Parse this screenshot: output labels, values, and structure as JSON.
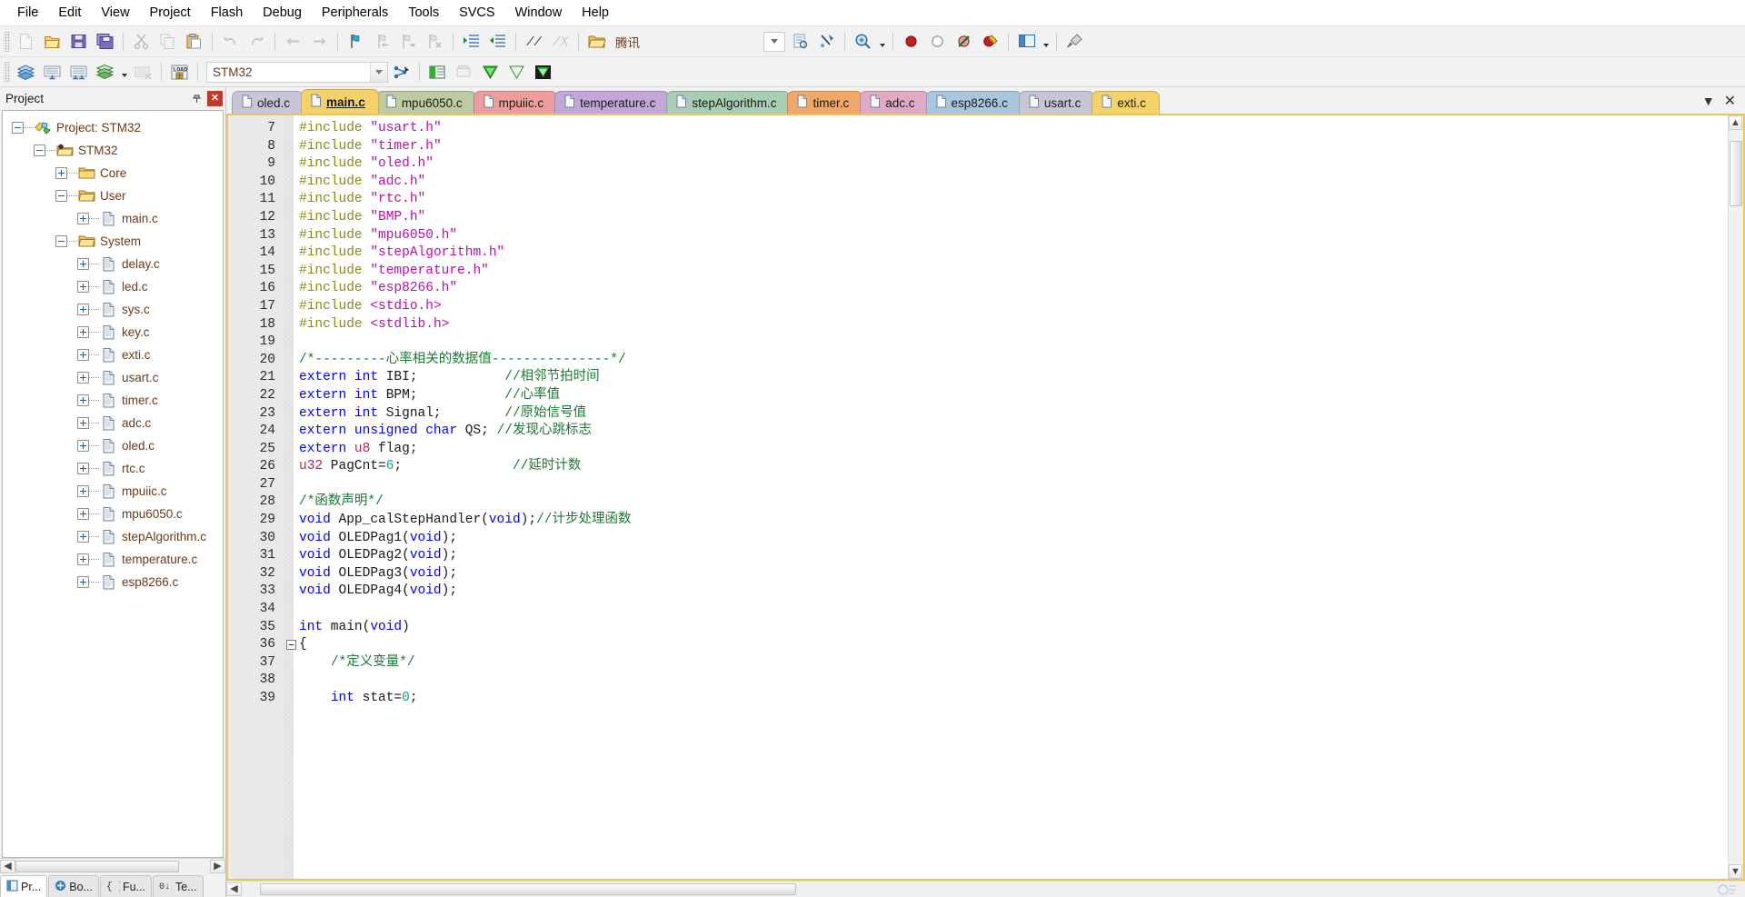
{
  "menu": {
    "items": [
      "File",
      "Edit",
      "View",
      "Project",
      "Flash",
      "Debug",
      "Peripherals",
      "Tools",
      "SVCS",
      "Window",
      "Help"
    ]
  },
  "toolbar1": {
    "buttons": [
      {
        "name": "new-file-button",
        "title": "New"
      },
      {
        "name": "open-file-button",
        "title": "Open"
      },
      {
        "name": "save-button",
        "title": "Save"
      },
      {
        "name": "save-all-button",
        "title": "Save All"
      },
      {
        "name": "cut-button",
        "title": "Cut"
      },
      {
        "name": "copy-button",
        "title": "Copy"
      },
      {
        "name": "paste-button",
        "title": "Paste"
      },
      {
        "name": "undo-button",
        "title": "Undo"
      },
      {
        "name": "redo-button",
        "title": "Redo"
      },
      {
        "name": "navigate-back-button",
        "title": "Back"
      },
      {
        "name": "navigate-forward-button",
        "title": "Forward"
      },
      {
        "name": "bookmark-toggle-button",
        "title": "Insert/Remove Bookmark"
      },
      {
        "name": "bookmark-prev-button",
        "title": "Previous Bookmark"
      },
      {
        "name": "bookmark-next-button",
        "title": "Next Bookmark"
      },
      {
        "name": "bookmark-clear-button",
        "title": "Clear All Bookmarks"
      },
      {
        "name": "indent-increase-button",
        "title": "Indent"
      },
      {
        "name": "indent-decrease-button",
        "title": "Outdent"
      },
      {
        "name": "comment-button",
        "title": "Comment"
      },
      {
        "name": "uncomment-button",
        "title": "Uncomment"
      },
      {
        "name": "open-folder-button",
        "title": "Open Containing Folder"
      }
    ],
    "tencent_label": "腾讯",
    "find_label": "",
    "debug_buttons": [
      {
        "name": "breakpoint-insert-button"
      },
      {
        "name": "breakpoint-disable-button"
      },
      {
        "name": "breakpoint-disable-all-button"
      },
      {
        "name": "breakpoint-kill-all-button"
      }
    ]
  },
  "toolbar2": {
    "buttons": [
      {
        "name": "build-target-button"
      },
      {
        "name": "translate-file-button"
      },
      {
        "name": "rebuild-all-button"
      },
      {
        "name": "batch-build-button"
      },
      {
        "name": "stop-build-button"
      },
      {
        "name": "download-to-flash-button"
      }
    ],
    "target_selector": {
      "value": "STM32",
      "name": "target-selector"
    },
    "after_buttons": [
      {
        "name": "target-options-button"
      },
      {
        "name": "manage-project-items-button"
      },
      {
        "name": "configuration-wizard-button"
      },
      {
        "name": "pack-installer-button"
      },
      {
        "name": "manage-run-time-environment-button"
      }
    ]
  },
  "project_pane": {
    "title": "Project",
    "pin_icon": "pin-icon",
    "close_icon": "close-icon",
    "tree": [
      {
        "label": "Project: STM32",
        "depth": 0,
        "state": "minus",
        "icon": "project-icon"
      },
      {
        "label": "STM32",
        "depth": 1,
        "state": "minus",
        "icon": "target-folder-icon"
      },
      {
        "label": "Core",
        "depth": 2,
        "state": "plus",
        "icon": "group-folder-icon"
      },
      {
        "label": "User",
        "depth": 2,
        "state": "minus",
        "icon": "group-folder-icon"
      },
      {
        "label": "main.c",
        "depth": 3,
        "state": "plus",
        "icon": "c-file-icon"
      },
      {
        "label": "System",
        "depth": 2,
        "state": "minus",
        "icon": "group-folder-icon"
      },
      {
        "label": "delay.c",
        "depth": 3,
        "state": "plus",
        "icon": "c-file-icon"
      },
      {
        "label": "led.c",
        "depth": 3,
        "state": "plus",
        "icon": "c-file-icon"
      },
      {
        "label": "sys.c",
        "depth": 3,
        "state": "plus",
        "icon": "c-file-icon"
      },
      {
        "label": "key.c",
        "depth": 3,
        "state": "plus",
        "icon": "c-file-icon"
      },
      {
        "label": "exti.c",
        "depth": 3,
        "state": "plus",
        "icon": "c-file-icon"
      },
      {
        "label": "usart.c",
        "depth": 3,
        "state": "plus",
        "icon": "c-file-icon"
      },
      {
        "label": "timer.c",
        "depth": 3,
        "state": "plus",
        "icon": "c-file-icon"
      },
      {
        "label": "adc.c",
        "depth": 3,
        "state": "plus",
        "icon": "c-file-icon"
      },
      {
        "label": "oled.c",
        "depth": 3,
        "state": "plus",
        "icon": "c-file-icon"
      },
      {
        "label": "rtc.c",
        "depth": 3,
        "state": "plus",
        "icon": "c-file-icon"
      },
      {
        "label": "mpuiic.c",
        "depth": 3,
        "state": "plus",
        "icon": "c-file-icon"
      },
      {
        "label": "mpu6050.c",
        "depth": 3,
        "state": "plus",
        "icon": "c-file-icon"
      },
      {
        "label": "stepAlgorithm.c",
        "depth": 3,
        "state": "plus",
        "icon": "c-file-icon"
      },
      {
        "label": "temperature.c",
        "depth": 3,
        "state": "plus",
        "icon": "c-file-icon"
      },
      {
        "label": "esp8266.c",
        "depth": 3,
        "state": "plus",
        "icon": "c-file-icon"
      }
    ],
    "bottom_tabs": [
      {
        "label": "Pr...",
        "icon": "project-tab-icon",
        "active": true
      },
      {
        "label": "Bo...",
        "icon": "books-tab-icon",
        "active": false
      },
      {
        "label": "Fu...",
        "icon": "functions-tab-icon",
        "active": false
      },
      {
        "label": "Te...",
        "icon": "templates-tab-icon",
        "active": false
      }
    ]
  },
  "editor": {
    "tabs": [
      {
        "label": "oled.c",
        "color": "#c8c6d6",
        "active": false
      },
      {
        "label": "main.c",
        "color": "#f5d269",
        "active": true
      },
      {
        "label": "mpu6050.c",
        "color": "#bccba2",
        "active": false
      },
      {
        "label": "mpuiic.c",
        "color": "#ed9d9d",
        "active": false
      },
      {
        "label": "temperature.c",
        "color": "#c2a8d8",
        "active": false
      },
      {
        "label": "stepAlgorithm.c",
        "color": "#a8cdb4",
        "active": false
      },
      {
        "label": "timer.c",
        "color": "#f0a868",
        "active": false
      },
      {
        "label": "adc.c",
        "color": "#dfaac4",
        "active": false
      },
      {
        "label": "esp8266.c",
        "color": "#a9c6dc",
        "active": false
      },
      {
        "label": "usart.c",
        "color": "#c8c6d6",
        "active": false
      },
      {
        "label": "exti.c",
        "color": "#f5d269",
        "active": false
      }
    ],
    "tab_list_icon": "tab-list-icon",
    "tab_close_icon": "close-icon",
    "first_line_number": 7,
    "lines": [
      {
        "n": 7,
        "tokens": [
          {
            "t": "#include ",
            "c": "pp"
          },
          {
            "t": "\"usart.h\"",
            "c": "st"
          }
        ]
      },
      {
        "n": 8,
        "tokens": [
          {
            "t": "#include ",
            "c": "pp"
          },
          {
            "t": "\"timer.h\"",
            "c": "st"
          }
        ]
      },
      {
        "n": 9,
        "tokens": [
          {
            "t": "#include ",
            "c": "pp"
          },
          {
            "t": "\"oled.h\"",
            "c": "st"
          }
        ]
      },
      {
        "n": 10,
        "tokens": [
          {
            "t": "#include ",
            "c": "pp"
          },
          {
            "t": "\"adc.h\"",
            "c": "st"
          }
        ]
      },
      {
        "n": 11,
        "tokens": [
          {
            "t": "#include ",
            "c": "pp"
          },
          {
            "t": "\"rtc.h\"",
            "c": "st"
          }
        ]
      },
      {
        "n": 12,
        "tokens": [
          {
            "t": "#include ",
            "c": "pp"
          },
          {
            "t": "\"BMP.h\"",
            "c": "st"
          }
        ]
      },
      {
        "n": 13,
        "tokens": [
          {
            "t": "#include ",
            "c": "pp"
          },
          {
            "t": "\"mpu6050.h\"",
            "c": "st"
          }
        ]
      },
      {
        "n": 14,
        "tokens": [
          {
            "t": "#include ",
            "c": "pp"
          },
          {
            "t": "\"stepAlgorithm.h\"",
            "c": "st"
          }
        ]
      },
      {
        "n": 15,
        "tokens": [
          {
            "t": "#include ",
            "c": "pp"
          },
          {
            "t": "\"temperature.h\"",
            "c": "st"
          }
        ]
      },
      {
        "n": 16,
        "tokens": [
          {
            "t": "#include ",
            "c": "pp"
          },
          {
            "t": "\"esp8266.h\"",
            "c": "st"
          }
        ]
      },
      {
        "n": 17,
        "tokens": [
          {
            "t": "#include ",
            "c": "pp"
          },
          {
            "t": "<stdio.h>",
            "c": "st"
          }
        ]
      },
      {
        "n": 18,
        "tokens": [
          {
            "t": "#include ",
            "c": "pp"
          },
          {
            "t": "<stdlib.h>",
            "c": "st"
          }
        ]
      },
      {
        "n": 19,
        "tokens": []
      },
      {
        "n": 20,
        "tokens": [
          {
            "t": "/*---------心率相关的数据值---------------*/",
            "c": "cm"
          }
        ]
      },
      {
        "n": 21,
        "tokens": [
          {
            "t": "extern int",
            "c": "k"
          },
          {
            "t": " IBI;           ",
            "c": "pl"
          },
          {
            "t": "//相邻节拍时间",
            "c": "cm"
          }
        ]
      },
      {
        "n": 22,
        "tokens": [
          {
            "t": "extern int",
            "c": "k"
          },
          {
            "t": " BPM;           ",
            "c": "pl"
          },
          {
            "t": "//心率值",
            "c": "cm"
          }
        ]
      },
      {
        "n": 23,
        "tokens": [
          {
            "t": "extern int",
            "c": "k"
          },
          {
            "t": " Signal;        ",
            "c": "pl"
          },
          {
            "t": "//原始信号值",
            "c": "cm"
          }
        ]
      },
      {
        "n": 24,
        "tokens": [
          {
            "t": "extern unsigned char",
            "c": "k"
          },
          {
            "t": " QS; ",
            "c": "pl"
          },
          {
            "t": "//发现心跳标志",
            "c": "cm"
          }
        ]
      },
      {
        "n": 25,
        "tokens": [
          {
            "t": "extern ",
            "c": "k"
          },
          {
            "t": "u8",
            "c": "ty"
          },
          {
            "t": " flag;",
            "c": "pl"
          }
        ]
      },
      {
        "n": 26,
        "tokens": [
          {
            "t": "u32",
            "c": "ty"
          },
          {
            "t": " PagCnt=",
            "c": "pl"
          },
          {
            "t": "6",
            "c": "nm"
          },
          {
            "t": ";              ",
            "c": "pl"
          },
          {
            "t": "//延时计数",
            "c": "cm"
          }
        ]
      },
      {
        "n": 27,
        "tokens": []
      },
      {
        "n": 28,
        "tokens": [
          {
            "t": "/*函数声明*/",
            "c": "cm"
          }
        ]
      },
      {
        "n": 29,
        "tokens": [
          {
            "t": "void",
            "c": "k"
          },
          {
            "t": " App_calStepHandler(",
            "c": "pl"
          },
          {
            "t": "void",
            "c": "k"
          },
          {
            "t": ");",
            "c": "pl"
          },
          {
            "t": "//计步处理函数",
            "c": "cm"
          }
        ]
      },
      {
        "n": 30,
        "tokens": [
          {
            "t": "void",
            "c": "k"
          },
          {
            "t": " OLEDPag1(",
            "c": "pl"
          },
          {
            "t": "void",
            "c": "k"
          },
          {
            "t": ");",
            "c": "pl"
          }
        ]
      },
      {
        "n": 31,
        "tokens": [
          {
            "t": "void",
            "c": "k"
          },
          {
            "t": " OLEDPag2(",
            "c": "pl"
          },
          {
            "t": "void",
            "c": "k"
          },
          {
            "t": ");",
            "c": "pl"
          }
        ]
      },
      {
        "n": 32,
        "tokens": [
          {
            "t": "void",
            "c": "k"
          },
          {
            "t": " OLEDPag3(",
            "c": "pl"
          },
          {
            "t": "void",
            "c": "k"
          },
          {
            "t": ");",
            "c": "pl"
          }
        ]
      },
      {
        "n": 33,
        "tokens": [
          {
            "t": "void",
            "c": "k"
          },
          {
            "t": " OLEDPag4(",
            "c": "pl"
          },
          {
            "t": "void",
            "c": "k"
          },
          {
            "t": ");",
            "c": "pl"
          }
        ]
      },
      {
        "n": 34,
        "tokens": []
      },
      {
        "n": 35,
        "tokens": [
          {
            "t": "int",
            "c": "k"
          },
          {
            "t": " main(",
            "c": "pl"
          },
          {
            "t": "void",
            "c": "k"
          },
          {
            "t": ")",
            "c": "pl"
          }
        ]
      },
      {
        "n": 36,
        "tokens": [
          {
            "t": "{",
            "c": "pl"
          }
        ],
        "fold": true
      },
      {
        "n": 37,
        "tokens": [
          {
            "t": "    ",
            "c": "pl"
          },
          {
            "t": "/*定义变量*/",
            "c": "cm"
          }
        ]
      },
      {
        "n": 38,
        "tokens": []
      },
      {
        "n": 39,
        "tokens": [
          {
            "t": "    ",
            "c": "pl"
          },
          {
            "t": "int",
            "c": "k"
          },
          {
            "t": " stat=",
            "c": "pl"
          },
          {
            "t": "0",
            "c": "nm"
          },
          {
            "t": ";",
            "c": "pl"
          }
        ]
      }
    ]
  }
}
